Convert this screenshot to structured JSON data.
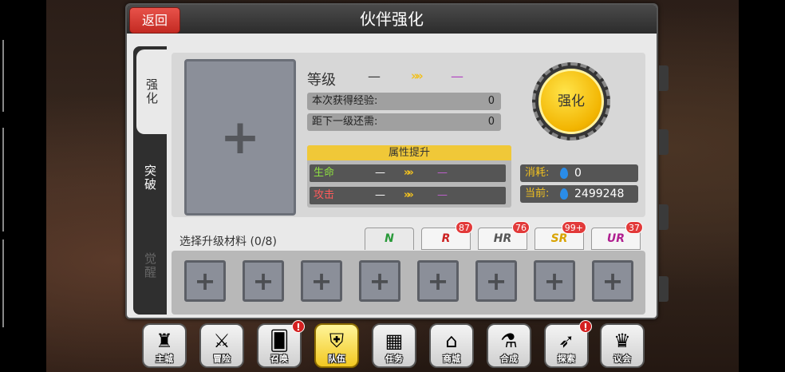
{
  "header": {
    "title": "伙伴强化",
    "back_label": "返回"
  },
  "side_tabs": [
    {
      "label": "强化",
      "active": true
    },
    {
      "label": "突破",
      "active": false
    },
    {
      "label": "觉醒",
      "active": false,
      "disabled": true
    }
  ],
  "level": {
    "label": "等级",
    "current": "—",
    "arrow": "»",
    "next": "—"
  },
  "exp": {
    "gained_label": "本次获得经验:",
    "gained_value": "0",
    "remaining_label": "距下一级还需:",
    "remaining_value": "0"
  },
  "attributes": {
    "header": "属性提升",
    "rows": [
      {
        "name": "生命",
        "current": "—",
        "arrow": "»",
        "next": "—"
      },
      {
        "name": "攻击",
        "current": "—",
        "arrow": "»",
        "next": "—"
      }
    ]
  },
  "upgrade_button": "强化",
  "cost": {
    "consume_label": "消耗:",
    "consume_value": "0",
    "current_label": "当前:",
    "current_value": "2499248"
  },
  "materials": {
    "label": "选择升级材料 (0/8)",
    "slot_count": 8,
    "slot_symbol": "+"
  },
  "big_slot_symbol": "+",
  "rarity_tabs": [
    {
      "label": "N",
      "badge": "",
      "color": "#2a9a3a"
    },
    {
      "label": "R",
      "badge": "87",
      "color": "#c22"
    },
    {
      "label": "HR",
      "badge": "76",
      "color": "#555"
    },
    {
      "label": "SR",
      "badge": "99+",
      "color": "#d9a300"
    },
    {
      "label": "UR",
      "badge": "37",
      "color": "#b02090"
    }
  ],
  "bottom_nav": [
    {
      "label": "主城",
      "icon": "castle-icon",
      "glyph": "♜",
      "alert": false,
      "active": false
    },
    {
      "label": "冒险",
      "icon": "swords-icon",
      "glyph": "⚔",
      "alert": false,
      "active": false
    },
    {
      "label": "召唤",
      "icon": "card-icon",
      "glyph": "🂠",
      "alert": true,
      "active": false
    },
    {
      "label": "队伍",
      "icon": "shield-wings-icon",
      "glyph": "⛨",
      "alert": false,
      "active": true
    },
    {
      "label": "任务",
      "icon": "map-icon",
      "glyph": "▦",
      "alert": false,
      "active": false
    },
    {
      "label": "商城",
      "icon": "shop-icon",
      "glyph": "⌂",
      "alert": false,
      "active": false
    },
    {
      "label": "合成",
      "icon": "potion-icon",
      "glyph": "⚗",
      "alert": false,
      "active": false
    },
    {
      "label": "探索",
      "icon": "crossbow-icon",
      "glyph": "➶",
      "alert": true,
      "active": false
    },
    {
      "label": "议会",
      "icon": "council-icon",
      "glyph": "♛",
      "alert": false,
      "active": false
    }
  ],
  "alert_symbol": "!"
}
